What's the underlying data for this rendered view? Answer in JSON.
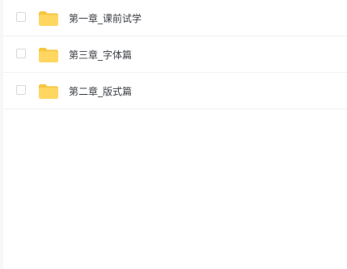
{
  "file_list": {
    "items": [
      {
        "name": "第一章_课前试学",
        "type_icon": "folder-icon",
        "checked": false
      },
      {
        "name": "第三章_字体篇",
        "type_icon": "folder-icon",
        "checked": false
      },
      {
        "name": "第二章_版式篇",
        "type_icon": "folder-icon",
        "checked": false
      }
    ]
  },
  "colors": {
    "folder": "#ffd660",
    "folder_tab": "#f7c640",
    "text": "#3c3f45",
    "divider": "#f1f2f4",
    "checkbox_border": "#d6d9de",
    "page_background": "#f7f7f8"
  }
}
